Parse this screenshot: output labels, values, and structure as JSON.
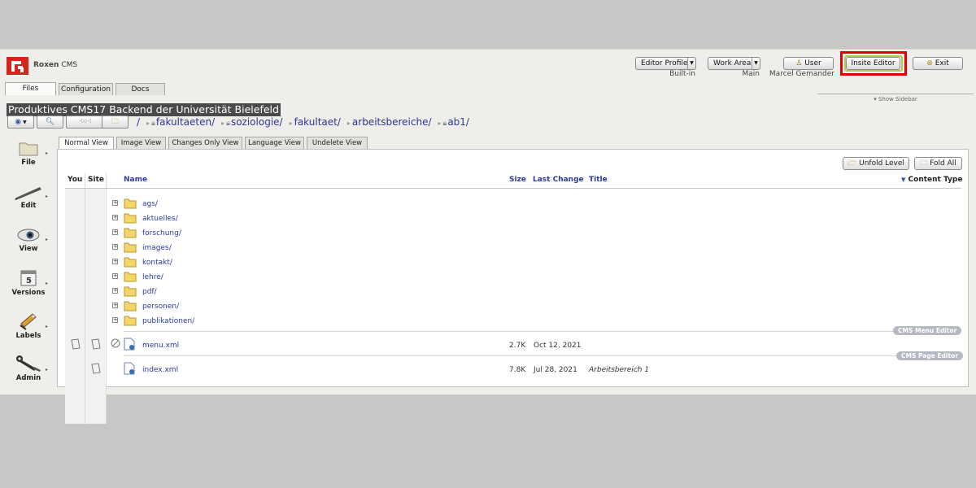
{
  "app": {
    "brand": "Roxen",
    "product": "CMS",
    "brand_color": "#d9241c"
  },
  "header": {
    "editor_profile": {
      "label": "Editor Profile",
      "value": "Built-in"
    },
    "work_area": {
      "label": "Work Area",
      "value": "Main"
    },
    "user": {
      "label": "User",
      "value": "Marcel Gemander"
    },
    "insite_editor": "Insite Editor",
    "exit": "Exit"
  },
  "tabs": [
    "Files",
    "Configuration",
    "Docs"
  ],
  "site_title": "Produktives CMS17 Backend der Universität Bielefeld",
  "show_sidebar": "Show Sidebar",
  "breadcrumb": {
    "root": "/",
    "items": [
      "fakultaeten/",
      "soziologie/",
      "fakultaet/",
      "arbeitsbereiche/",
      "ab1/"
    ]
  },
  "sidebar": [
    {
      "label": "File",
      "icon": "folder-icon"
    },
    {
      "label": "Edit",
      "icon": "pen-icon"
    },
    {
      "label": "View",
      "icon": "eye-icon"
    },
    {
      "label": "Versions",
      "icon": "calendar-icon"
    },
    {
      "label": "Labels",
      "icon": "labels-icon"
    },
    {
      "label": "Admin",
      "icon": "wrench-icon"
    }
  ],
  "view_tabs": [
    "Normal View",
    "Image View",
    "Changes Only View",
    "Language View",
    "Undelete View"
  ],
  "actions": {
    "unfold": "Unfold Level",
    "fold_all": "Fold All"
  },
  "columns": {
    "you": "You",
    "site": "Site",
    "name": "Name",
    "size": "Size",
    "last_change": "Last Change",
    "title": "Title",
    "content_type": "Content Type"
  },
  "folders": [
    "ags/",
    "aktuelles/",
    "forschung/",
    "images/",
    "kontakt/",
    "lehre/",
    "pdf/",
    "personen/",
    "publikationen/"
  ],
  "files": [
    {
      "name": "menu.xml",
      "size": "2.7K",
      "date": "Oct 12, 2021",
      "title": "",
      "badge": "CMS Menu Editor"
    },
    {
      "name": "index.xml",
      "size": "7.8K",
      "date": "Jul 28, 2021",
      "title": "Arbeitsbereich 1",
      "badge": "CMS Page Editor"
    }
  ]
}
